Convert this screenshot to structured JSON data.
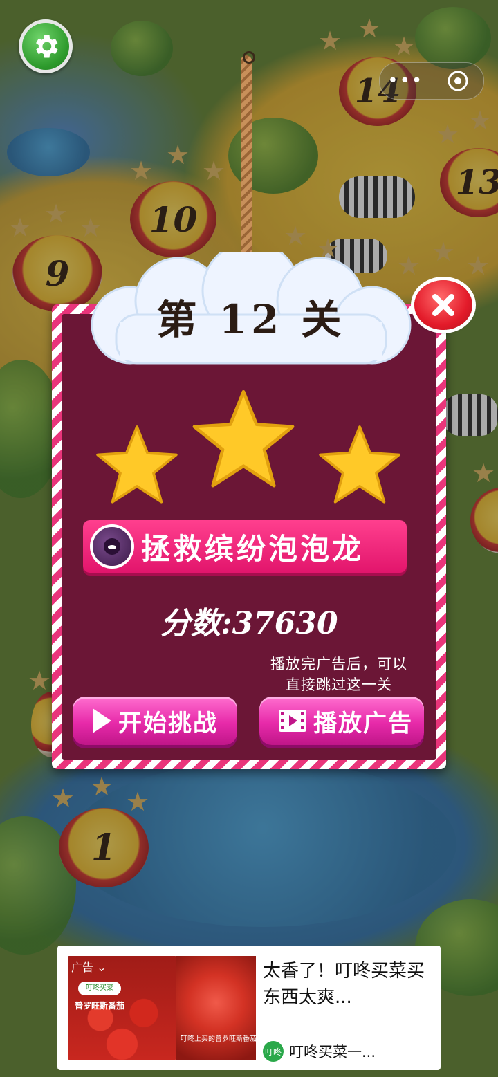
{
  "map": {
    "level_labels": [
      "14",
      "13",
      "10",
      "9",
      "1"
    ]
  },
  "top": {
    "settings_icon": "gear-icon",
    "more_label": "•••",
    "target_icon": "target-icon"
  },
  "dialog": {
    "title": "第 12 关",
    "stars_earned": 3,
    "stars_total": 3,
    "nickname": "拯救缤纷泡泡龙",
    "score_text": "分数:37630",
    "hint_line1": "播放完广告后，可以",
    "hint_line2": "直接跳过这一关",
    "start_label": "开始挑战",
    "ad_label": "播放广告",
    "close_icon": "close-icon"
  },
  "ad": {
    "tag": "广告 ⌄",
    "brand_text": "叮咚买菜",
    "product_text": "普罗旺斯番茄",
    "caption_text": "叮咚上买的普罗旺斯番茄",
    "title": "太香了！叮咚买菜买东西太爽...",
    "source": "叮咚买菜一...",
    "source_logo_text": "叮咚"
  },
  "colors": {
    "panel_bg": "#6b1636",
    "stripe": "#e9357b",
    "star": "#ffc928",
    "button": "#e72aa9",
    "nickname_bar": "#e2156c",
    "close": "#e31b2a"
  }
}
